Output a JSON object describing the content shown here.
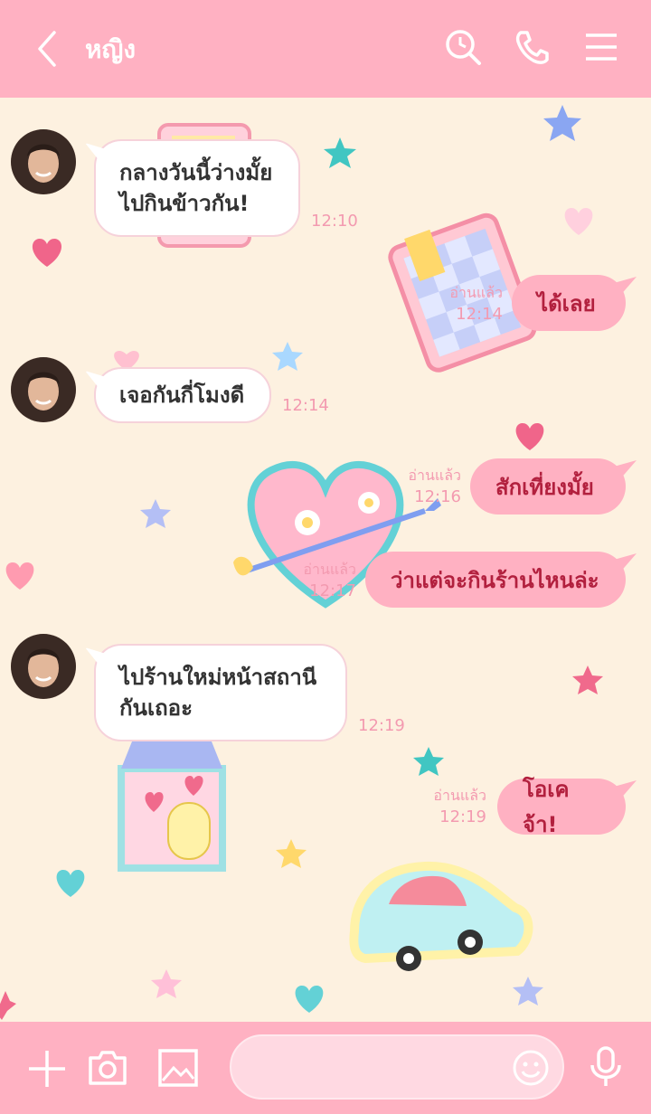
{
  "header": {
    "title": "หญิง",
    "icons": [
      "back-icon",
      "search-icon",
      "phone-icon",
      "menu-icon"
    ]
  },
  "messages": [
    {
      "dir": "in",
      "text": [
        "กลางวันนี้ว่างมั้ย",
        "ไปกินข้าวกัน!"
      ],
      "time": "12:10"
    },
    {
      "dir": "out",
      "text": "ได้เลย",
      "read": "อ่านแล้ว",
      "time": "12:14"
    },
    {
      "dir": "in",
      "text": [
        "เจอกันกี่โมงดี"
      ],
      "time": "12:14"
    },
    {
      "dir": "out",
      "text": "สักเที่ยงมั้ย",
      "read": "อ่านแล้ว",
      "time": "12:16"
    },
    {
      "dir": "out",
      "text": "ว่าแต่จะกินร้านไหนล่ะ",
      "read": "อ่านแล้ว",
      "time": "12:17"
    },
    {
      "dir": "in",
      "text": [
        "ไปร้านใหม่หน้าสถานี",
        "กันเถอะ"
      ],
      "time": "12:19"
    },
    {
      "dir": "out",
      "text": "โอเคจ้า!",
      "read": "อ่านแล้ว",
      "time": "12:19"
    }
  ],
  "footer": {
    "input_value": "",
    "icons": [
      "plus-icon",
      "camera-icon",
      "image-icon",
      "emoji-icon",
      "microphone-icon"
    ]
  },
  "colors": {
    "header": "#ffb1c2",
    "background": "#fdf1e0",
    "outgoing_bubble": "#ffb1c2",
    "outgoing_text": "#b2203e",
    "time_text": "#f39ab0"
  }
}
